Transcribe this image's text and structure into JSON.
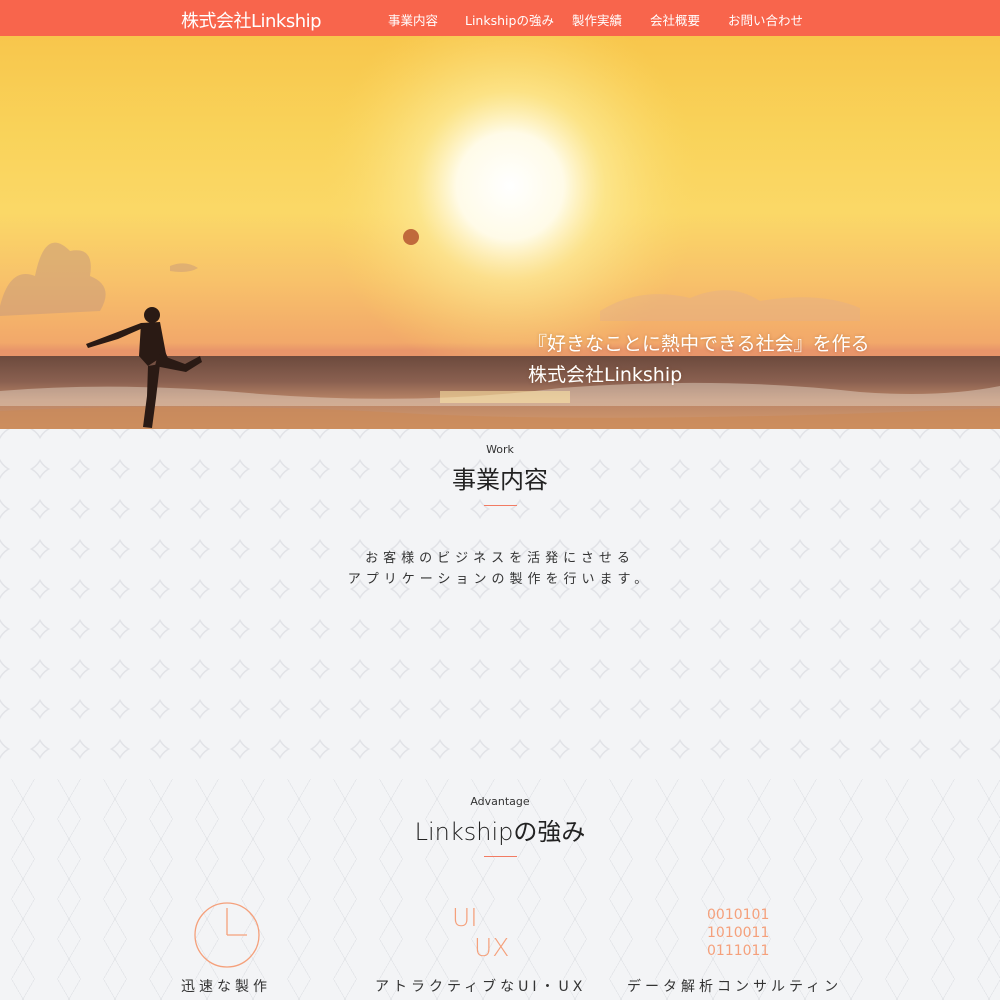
{
  "header": {
    "brand": "株式会社Linkship",
    "nav": [
      {
        "label": "事業内容"
      },
      {
        "label": "Linkshipの強み"
      },
      {
        "label": "製作実績"
      },
      {
        "label": "会社概要"
      },
      {
        "label": "お問い合わせ"
      }
    ]
  },
  "hero": {
    "tagline_line1": "『好きなことに熱中できる社会』を作る",
    "tagline_line2": "株式会社Linkship"
  },
  "work": {
    "eyebrow": "Work",
    "title": "事業内容",
    "text_line1": "お客様のビジネスを活発にさせる",
    "text_line2": "アプリケーションの製作を行います。"
  },
  "advantage": {
    "eyebrow": "Advantage",
    "title": "Linkshipの強み",
    "items": [
      {
        "label": "迅速な製作",
        "icon": "clock-icon"
      },
      {
        "label": "アトラクティブなUI・UX",
        "icon": "ui-ux-icon",
        "icon_text_1": "UI",
        "icon_text_2": "UX"
      },
      {
        "label": "データ解析コンサルティン",
        "icon": "binary-icon",
        "icon_text": "0010101\n1010011\n0111011"
      }
    ]
  },
  "colors": {
    "accent": "#f8654c",
    "icon": "#f5a07b"
  }
}
